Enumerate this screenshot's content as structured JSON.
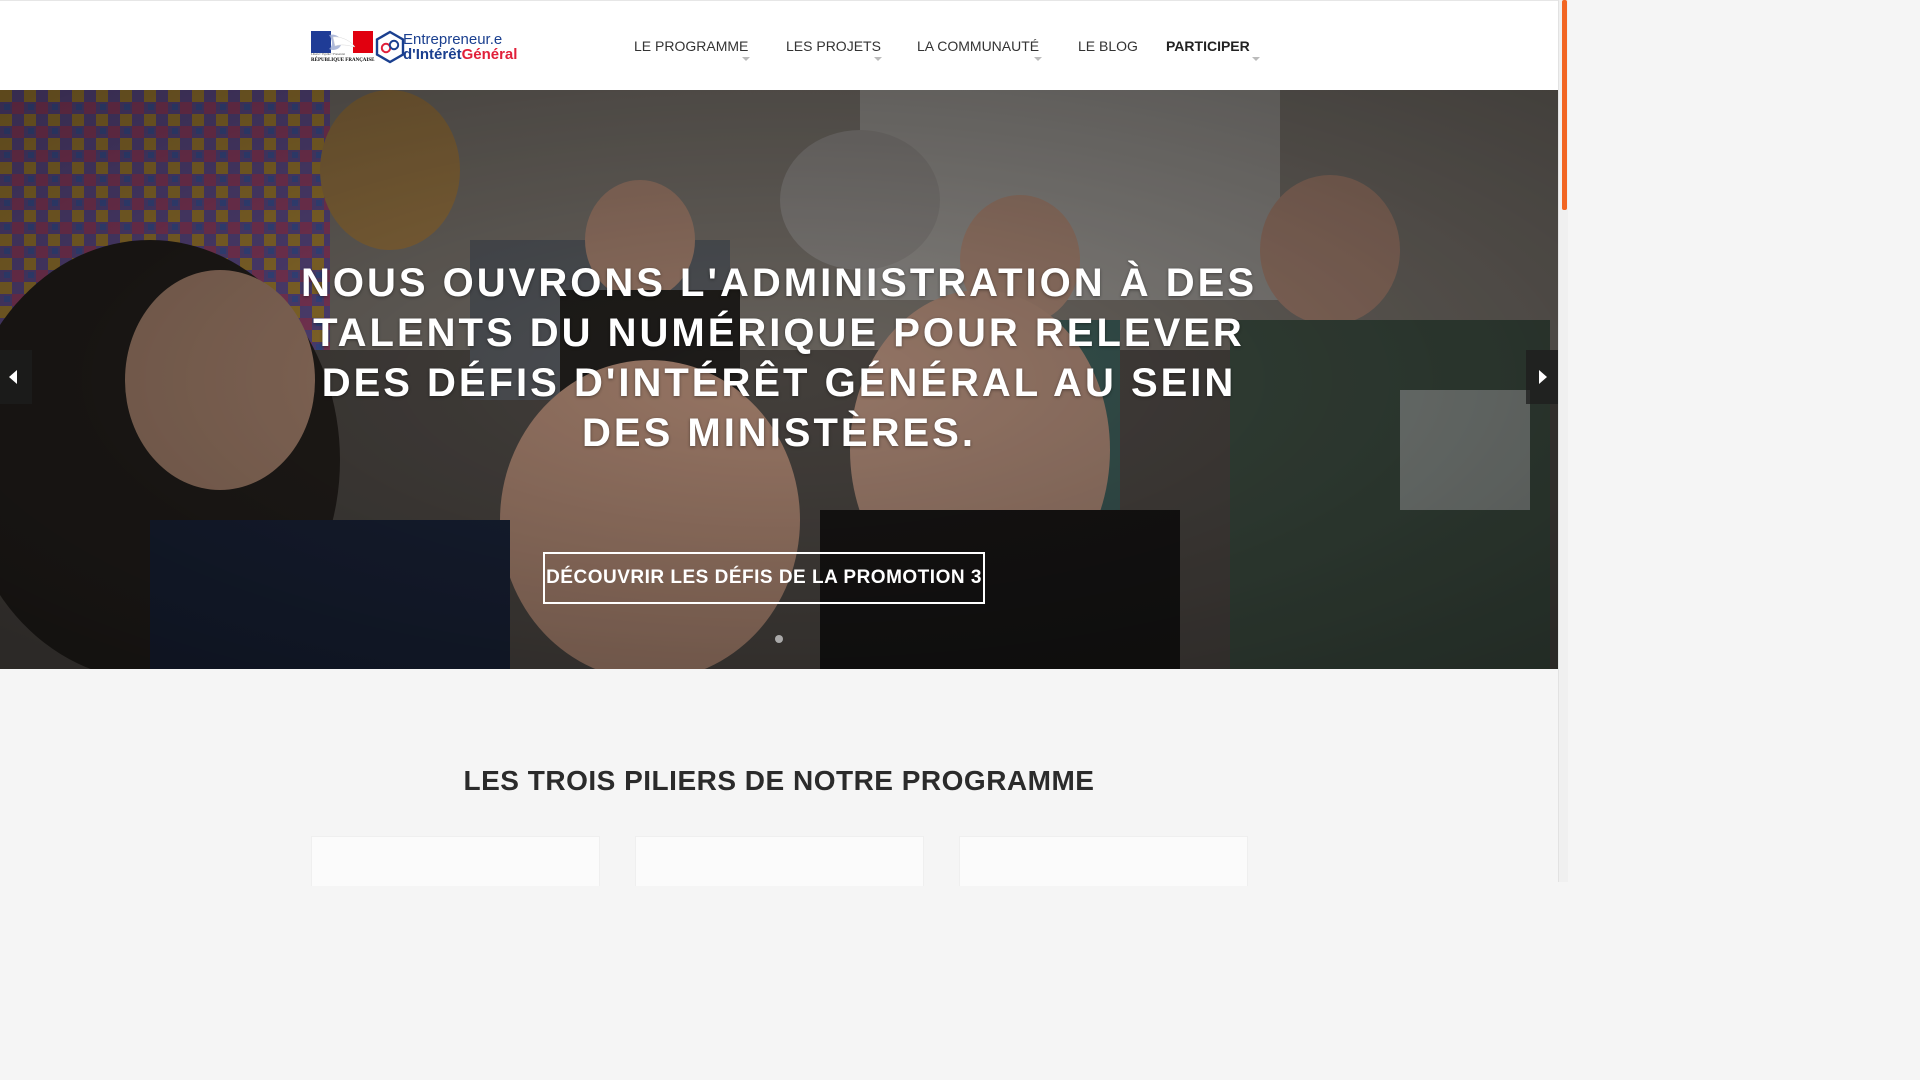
{
  "header": {
    "logo": {
      "rf_motto": "Liberté • Égalité • Fraternité",
      "rf_name": "RÉPUBLIQUE FRANÇAISE",
      "line1": "Entrepreneur.e",
      "line2_a": "d'Intérêt",
      "line2_b": "Général"
    },
    "nav": {
      "programme": "LE PROGRAMME",
      "projets": "LES PROJETS",
      "communaute": "LA COMMUNAUTÉ",
      "blog": "LE BLOG",
      "participer": "PARTICIPER"
    }
  },
  "hero": {
    "title": "NOUS OUVRONS L'ADMINISTRATION À DES TALENTS DU NUMÉRIQUE POUR RELEVER DES DÉFIS D'INTÉRÊT GÉNÉRAL AU SEIN DES MINISTÈRES.",
    "cta": "DÉCOUVRIR LES DÉFIS DE LA PROMOTION 3",
    "prev_icon": "arrow-left-icon",
    "next_icon": "arrow-right-icon"
  },
  "section": {
    "title": "LES TROIS PILIERS DE NOTRE PROGRAMME"
  },
  "colors": {
    "brand_blue": "#1a3f8f",
    "brand_red": "#e1203a",
    "scroll_accent": "#f26522"
  }
}
